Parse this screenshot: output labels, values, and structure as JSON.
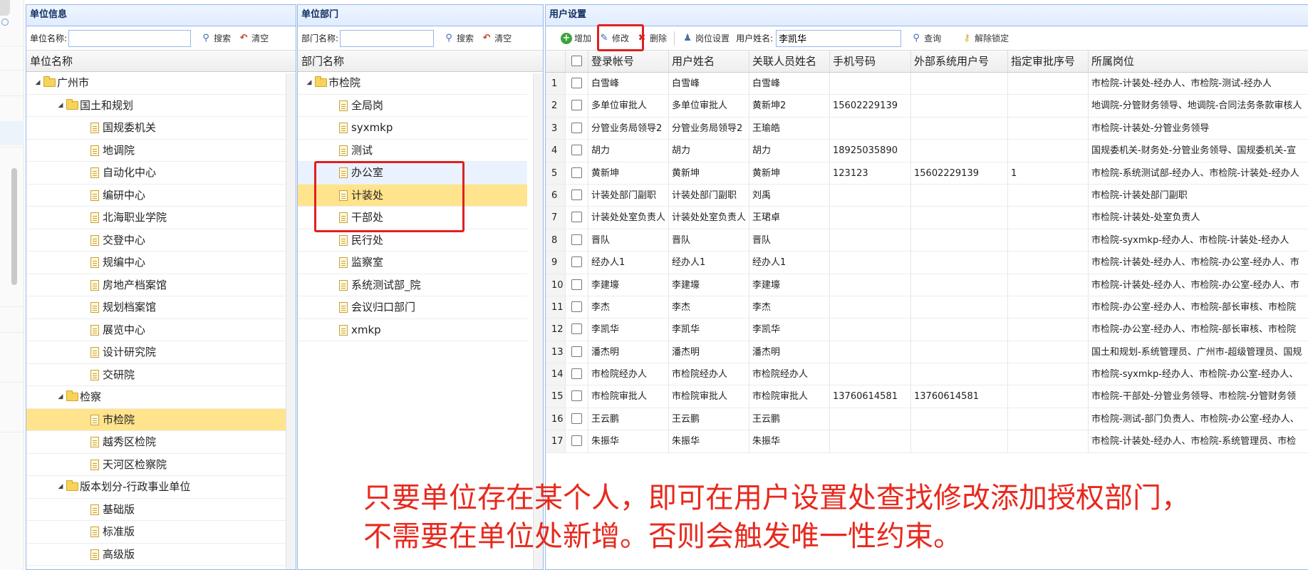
{
  "panels": {
    "unit": {
      "title": "单位信息",
      "search_label": "单位名称:",
      "search_value": "",
      "search_btn": "搜索",
      "clear_btn": "清空",
      "col_header": "单位名称",
      "tree": [
        {
          "label": "广州市",
          "level": 0,
          "type": "folder",
          "expanded": true
        },
        {
          "label": "国土和规划",
          "level": 1,
          "type": "folder",
          "expanded": true
        },
        {
          "label": "国规委机关",
          "level": 2,
          "type": "file"
        },
        {
          "label": "地调院",
          "level": 2,
          "type": "file"
        },
        {
          "label": "自动化中心",
          "level": 2,
          "type": "file"
        },
        {
          "label": "编研中心",
          "level": 2,
          "type": "file"
        },
        {
          "label": "北海职业学院",
          "level": 2,
          "type": "file"
        },
        {
          "label": "交登中心",
          "level": 2,
          "type": "file"
        },
        {
          "label": "规编中心",
          "level": 2,
          "type": "file"
        },
        {
          "label": "房地产档案馆",
          "level": 2,
          "type": "file"
        },
        {
          "label": "规划档案馆",
          "level": 2,
          "type": "file"
        },
        {
          "label": "展览中心",
          "level": 2,
          "type": "file"
        },
        {
          "label": "设计研究院",
          "level": 2,
          "type": "file"
        },
        {
          "label": "交研院",
          "level": 2,
          "type": "file"
        },
        {
          "label": "检察",
          "level": 1,
          "type": "folder",
          "expanded": true
        },
        {
          "label": "市检院",
          "level": 2,
          "type": "file",
          "selected": true
        },
        {
          "label": "越秀区检院",
          "level": 2,
          "type": "file"
        },
        {
          "label": "天河区检察院",
          "level": 2,
          "type": "file"
        },
        {
          "label": "版本划分-行政事业单位",
          "level": 1,
          "type": "folder",
          "expanded": true
        },
        {
          "label": "基础版",
          "level": 2,
          "type": "file"
        },
        {
          "label": "标准版",
          "level": 2,
          "type": "file"
        },
        {
          "label": "高级版",
          "level": 2,
          "type": "file"
        }
      ]
    },
    "dept": {
      "title": "单位部门",
      "search_label": "部门名称:",
      "search_value": "",
      "search_btn": "搜索",
      "clear_btn": "清空",
      "col_header": "部门名称",
      "tree": [
        {
          "label": "市检院",
          "level": 0,
          "type": "folder",
          "expanded": true
        },
        {
          "label": "全局岗",
          "level": 1,
          "type": "file"
        },
        {
          "label": "syxmkp",
          "level": 1,
          "type": "file"
        },
        {
          "label": "测试",
          "level": 1,
          "type": "file"
        },
        {
          "label": "办公室",
          "level": 1,
          "type": "file",
          "hover": true
        },
        {
          "label": "计装处",
          "level": 1,
          "type": "file",
          "selected": true
        },
        {
          "label": "干部处",
          "level": 1,
          "type": "file"
        },
        {
          "label": "民行处",
          "level": 1,
          "type": "file"
        },
        {
          "label": "监察室",
          "level": 1,
          "type": "file"
        },
        {
          "label": "系统测试部_院",
          "level": 1,
          "type": "file"
        },
        {
          "label": "会议归口部门",
          "level": 1,
          "type": "file"
        },
        {
          "label": "xmkp",
          "level": 1,
          "type": "file"
        }
      ]
    },
    "user": {
      "title": "用户设置",
      "toolbar": {
        "add": "增加",
        "edit": "修改",
        "delete": "删除",
        "post_settings": "岗位设置",
        "name_label": "用户姓名:",
        "name_value": "李凯华",
        "query": "查询",
        "unlock": "解除锁定"
      },
      "columns": [
        "登录帐号",
        "用户姓名",
        "关联人员姓名",
        "手机号码",
        "外部系统用户号",
        "指定审批序号",
        "所属岗位"
      ],
      "rows": [
        {
          "n": "1",
          "login": "白雪峰",
          "name": "白雪峰",
          "rel": "白雪峰",
          "phone": "",
          "ext": "",
          "seq": "",
          "post": "市检院-计装处-经办人、市检院-测试-经办人"
        },
        {
          "n": "2",
          "login": "多单位审批人",
          "name": "多单位审批人",
          "rel": "黄新坤2",
          "phone": "15602229139",
          "ext": "",
          "seq": "",
          "post": "地调院-分管财务领导、地调院-合同法务条款审核人"
        },
        {
          "n": "3",
          "login": "分管业务局领导2",
          "name": "分管业务局领导2",
          "rel": "王瑜皓",
          "phone": "",
          "ext": "",
          "seq": "",
          "post": "市检院-计装处-分管业务领导"
        },
        {
          "n": "4",
          "login": "胡力",
          "name": "胡力",
          "rel": "胡力",
          "phone": "18925035890",
          "ext": "",
          "seq": "",
          "post": "国规委机关-财务处-分管业务领导、国规委机关-宣"
        },
        {
          "n": "5",
          "login": "黄新坤",
          "name": "黄新坤",
          "rel": "黄新坤",
          "phone": "123123",
          "ext": "15602229139",
          "seq": "1",
          "post": "市检院-系统测试部-经办人、市检院-计装处-经办人"
        },
        {
          "n": "6",
          "login": "计装处部门副职",
          "name": "计装处部门副职",
          "rel": "刘禹",
          "phone": "",
          "ext": "",
          "seq": "",
          "post": "市检院-计装处部门副职"
        },
        {
          "n": "7",
          "login": "计装处处室负责人",
          "name": "计装处处室负责人",
          "rel": "王珺卓",
          "phone": "",
          "ext": "",
          "seq": "",
          "post": "市检院-计装处-处室负责人"
        },
        {
          "n": "8",
          "login": "晋队",
          "name": "晋队",
          "rel": "晋队",
          "phone": "",
          "ext": "",
          "seq": "",
          "post": "市检院-syxmkp-经办人、市检院-计装处-经办人"
        },
        {
          "n": "9",
          "login": "经办人1",
          "name": "经办人1",
          "rel": "经办人1",
          "phone": "",
          "ext": "",
          "seq": "",
          "post": "市检院-计装处-经办人、市检院-办公室-经办人、市"
        },
        {
          "n": "10",
          "login": "李建壕",
          "name": "李建壕",
          "rel": "李建壕",
          "phone": "",
          "ext": "",
          "seq": "",
          "post": "市检院-计装处-经办人、市检院-办公室-经办人、市"
        },
        {
          "n": "11",
          "login": "李杰",
          "name": "李杰",
          "rel": "李杰",
          "phone": "",
          "ext": "",
          "seq": "",
          "post": "市检院-办公室-经办人、市检院-部长审核、市检院"
        },
        {
          "n": "12",
          "login": "李凯华",
          "name": "李凯华",
          "rel": "李凯华",
          "phone": "",
          "ext": "",
          "seq": "",
          "post": "市检院-办公室-经办人、市检院-部长审核、市检院"
        },
        {
          "n": "13",
          "login": "潘杰明",
          "name": "潘杰明",
          "rel": "潘杰明",
          "phone": "",
          "ext": "",
          "seq": "",
          "post": "国土和规划-系统管理员、广州市-超级管理员、国规"
        },
        {
          "n": "14",
          "login": "市检院经办人",
          "name": "市检院经办人",
          "rel": "市检院经办人",
          "phone": "",
          "ext": "",
          "seq": "",
          "post": "市检院-syxmkp-经办人、市检院-办公室-经办人、"
        },
        {
          "n": "15",
          "login": "市检院审批人",
          "name": "市检院审批人",
          "rel": "市检院审批人",
          "phone": "13760614581",
          "ext": "13760614581",
          "seq": "",
          "post": "市检院-干部处-分管业务领导、市检院-分管财务领"
        },
        {
          "n": "16",
          "login": "王云鹏",
          "name": "王云鹏",
          "rel": "王云鹏",
          "phone": "",
          "ext": "",
          "seq": "",
          "post": "市检院-测试-部门负责人、市检院-办公室-经办人、"
        },
        {
          "n": "17",
          "login": "朱振华",
          "name": "朱振华",
          "rel": "朱振华",
          "phone": "",
          "ext": "",
          "seq": "",
          "post": "市检院-计装处-经办人、市检院-系统管理员、市检"
        }
      ]
    }
  },
  "annotation": {
    "line1": "只要单位存在某个人，即可在用户设置处查找修改添加授权部门，",
    "line2": "不需要在单位处新增。否则会触发唯一性约束。"
  },
  "colors": {
    "panel_border": "#95b8e7",
    "selected_row": "#ffe48d",
    "annotation_red": "#e8291e",
    "highlight_box": "#e02020"
  },
  "icons": [
    "search-icon",
    "clear-icon",
    "add-icon",
    "edit-icon",
    "delete-icon",
    "post-settings-icon",
    "unlock-icon",
    "folder-icon",
    "file-icon",
    "expand-arrow-icon"
  ]
}
